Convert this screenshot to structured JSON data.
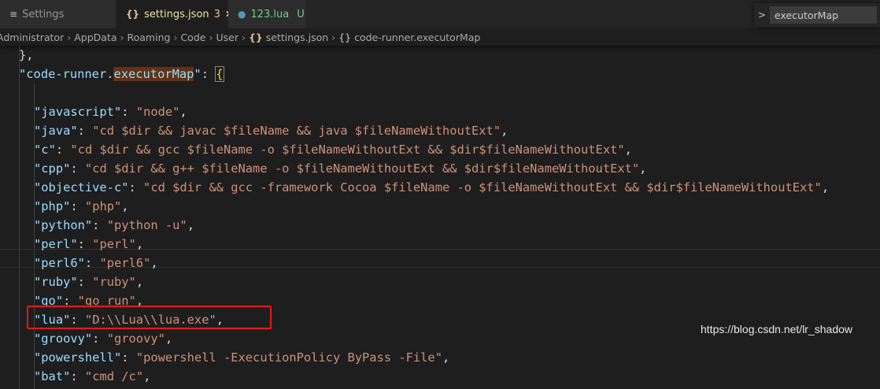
{
  "tabs": [
    {
      "label": "Settings",
      "icon": "menu-icon"
    },
    {
      "label": "settings.json",
      "badge": "3",
      "icon": "json-braces-icon",
      "close": "✕",
      "active": true
    },
    {
      "label": "123.lua",
      "status": "U",
      "icon": "lua-icon"
    }
  ],
  "breadcrumb": [
    "Administrator",
    "AppData",
    "Roaming",
    "Code",
    "User",
    "settings.json",
    "code-runner.executorMap"
  ],
  "find": {
    "value": "executorMap",
    "toggle": ">"
  },
  "code": {
    "line0": "},",
    "map_key_q1": "\"",
    "map_key_a": "code-runner.",
    "map_key_b": "executorMap",
    "map_key_q2": "\"",
    "map_colon": ": ",
    "map_brace": "{",
    "entries": [
      {
        "key": "javascript",
        "value": "node"
      },
      {
        "key": "java",
        "value": "cd $dir && javac $fileName && java $fileNameWithoutExt"
      },
      {
        "key": "c",
        "value": "cd $dir && gcc $fileName -o $fileNameWithoutExt && $dir$fileNameWithoutExt"
      },
      {
        "key": "cpp",
        "value": "cd $dir && g++ $fileName -o $fileNameWithoutExt && $dir$fileNameWithoutExt"
      },
      {
        "key": "objective-c",
        "value": "cd $dir && gcc -framework Cocoa $fileName -o $fileNameWithoutExt && $dir$fileNameWithoutExt"
      },
      {
        "key": "php",
        "value": "php"
      },
      {
        "key": "python",
        "value": "python -u"
      },
      {
        "key": "perl",
        "value": "perl"
      },
      {
        "key": "perl6",
        "value": "perl6"
      },
      {
        "key": "ruby",
        "value": "ruby"
      },
      {
        "key": "go",
        "value": "go run"
      },
      {
        "key": "lua",
        "value": "D:\\\\Lua\\\\lua.exe"
      },
      {
        "key": "groovy",
        "value": "groovy"
      },
      {
        "key": "powershell",
        "value": "powershell -ExecutionPolicy ByPass -File"
      },
      {
        "key": "bat",
        "value": "cmd /c"
      }
    ]
  },
  "watermark": "https://blog.csdn.net/lr_shadow",
  "colors": {
    "key": "#9cdcfe",
    "string": "#ce9178",
    "highlight": "#613214",
    "annotation": "#e81818"
  }
}
